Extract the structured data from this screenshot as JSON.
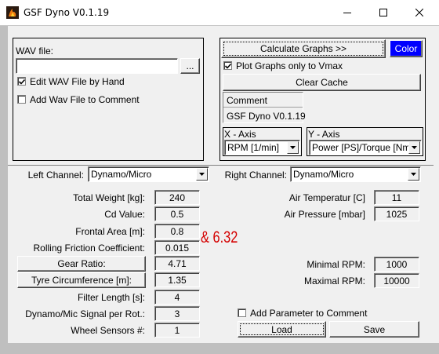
{
  "window": {
    "title": "GSF Dyno V0.1.19",
    "controls": [
      "minimize",
      "maximize",
      "close"
    ]
  },
  "wav": {
    "label": "WAV file:",
    "path_value": "",
    "browse_label": "...",
    "edit_checkbox": {
      "label": "Edit WAV File by Hand",
      "checked": true
    },
    "comment_checkbox": {
      "label": "Add Wav File to Comment",
      "checked": false
    }
  },
  "graphs": {
    "calculate_label": "Calculate Graphs >>",
    "color_label": "Color",
    "color_button_bg": "#0000ff",
    "plot_vmax": {
      "label": "Plot Graphs only to Vmax",
      "checked": true
    },
    "clear_cache_label": "Clear Cache",
    "comment_label": "Comment",
    "comment_value": "GSF Dyno V0.1.19",
    "x_axis": {
      "label": "X - Axis",
      "value": "RPM [1/min]"
    },
    "y_axis": {
      "label": "Y - Axis",
      "value": "Power [PS]/Torque [Nm]"
    }
  },
  "channels": {
    "left_label": "Left Channel:",
    "left_value": "Dynamo/Micro",
    "right_label": "Right Channel:",
    "right_value": "Dynamo/Micro"
  },
  "params": {
    "total_weight": {
      "label": "Total Weight [kg]:",
      "value": "240"
    },
    "cd_value": {
      "label": "Cd Value:",
      "value": "0.5"
    },
    "frontal_area": {
      "label": "Frontal Area [m]:",
      "value": "0.8"
    },
    "rolling_friction": {
      "label": "Rolling Friction Coefficient:",
      "value": "0.015"
    },
    "gear_ratio": {
      "label": "Gear Ratio:",
      "value": "4.71"
    },
    "tyre_circumference": {
      "label": "Tyre Circumference [m]:",
      "value": "1.35"
    },
    "filter_length": {
      "label": "Filter Length [s]:",
      "value": "4"
    },
    "signal_per_rot": {
      "label": "Dynamo/Mic Signal per Rot.:",
      "value": "3"
    },
    "wheel_sensors": {
      "label": "Wheel Sensors #:",
      "value": "1"
    },
    "air_temperature": {
      "label": "Air Temperatur [C]",
      "value": "11"
    },
    "air_pressure": {
      "label": "Air Pressure [mbar]",
      "value": "1025"
    },
    "min_rpm": {
      "label": "Minimal RPM:",
      "value": "1000"
    },
    "max_rpm": {
      "label": "Maximal RPM:",
      "value": "10000"
    }
  },
  "annotation": {
    "text": "& 6.32",
    "color": "#d40000"
  },
  "actions": {
    "add_param_comment": {
      "label": "Add Parameter to Comment",
      "checked": false
    },
    "load_label": "Load",
    "save_label": "Save"
  }
}
